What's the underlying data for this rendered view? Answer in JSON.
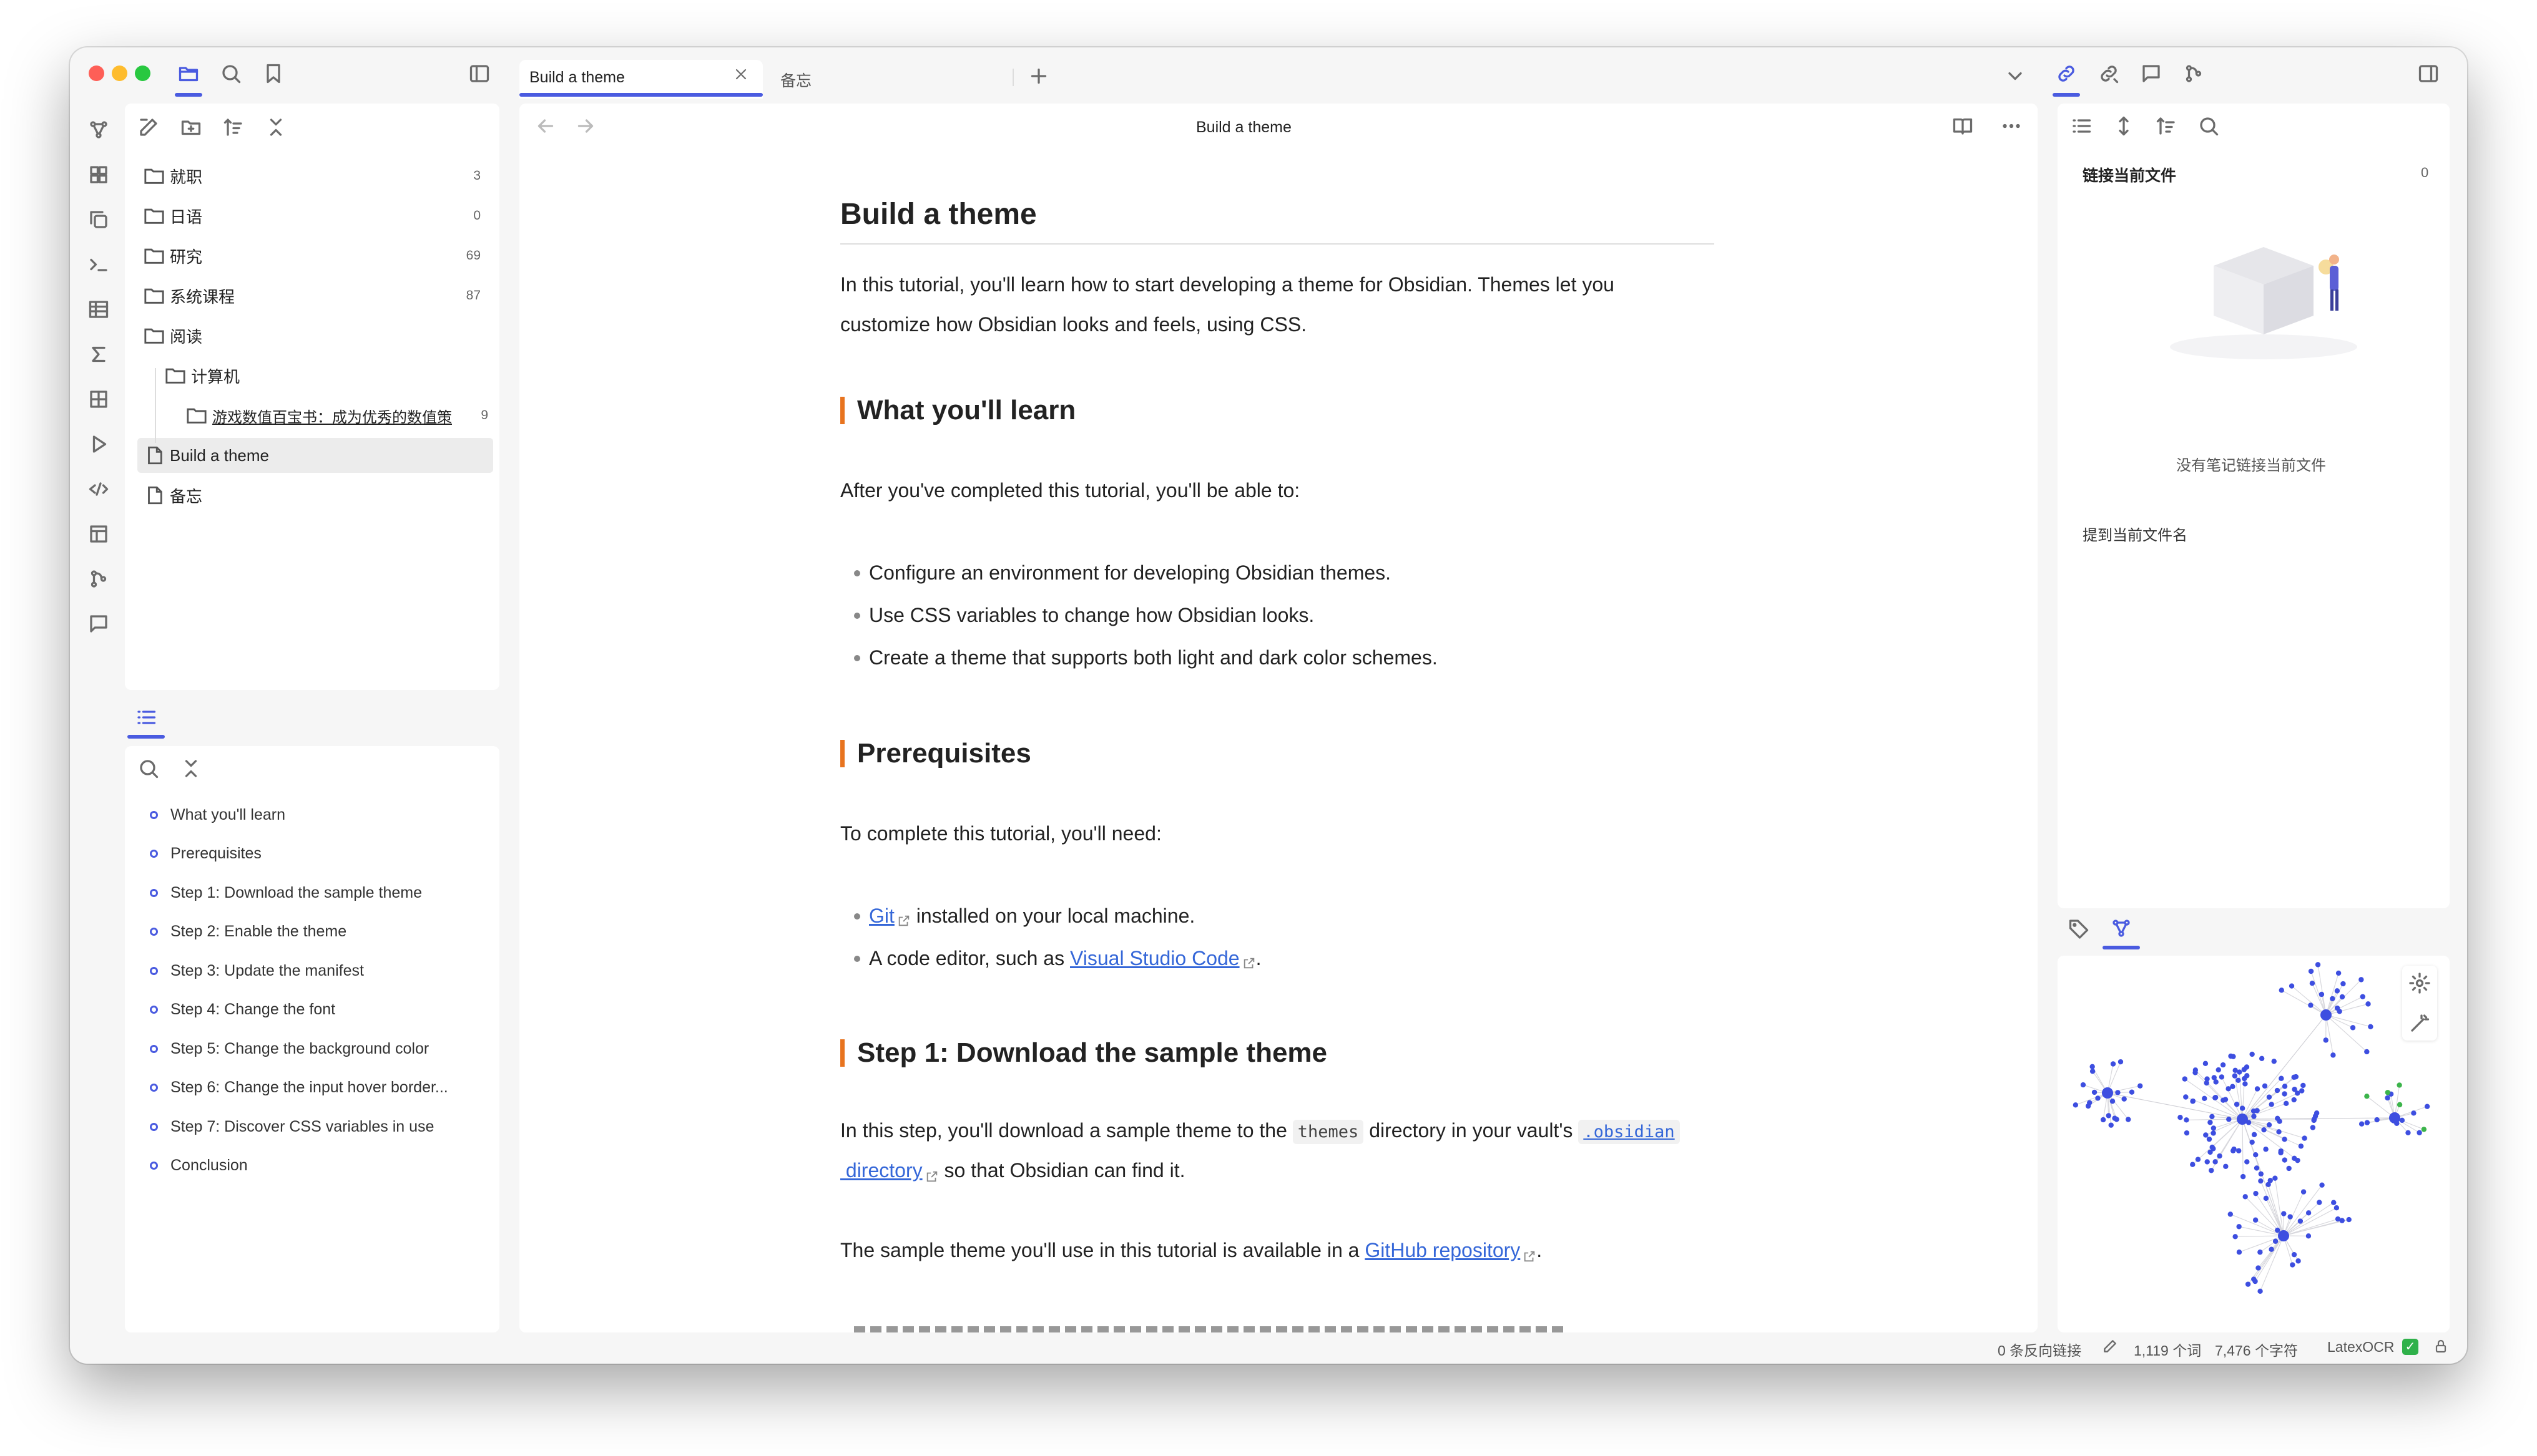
{
  "titlebar": {
    "tabs": [
      {
        "label": "Build a theme",
        "active": true
      },
      {
        "label": "备忘",
        "active": false
      }
    ]
  },
  "left_panel": {
    "tree": [
      {
        "label": "就职",
        "count": "3",
        "type": "folder",
        "level": 0
      },
      {
        "label": "日语",
        "count": "0",
        "type": "folder",
        "level": 0
      },
      {
        "label": "研究",
        "count": "69",
        "type": "folder",
        "level": 0
      },
      {
        "label": "系统课程",
        "count": "87",
        "type": "folder",
        "level": 0
      },
      {
        "label": "阅读",
        "count": "",
        "type": "folder-open",
        "level": 0
      },
      {
        "label": "计算机",
        "count": "",
        "type": "folder-open",
        "level": 1
      },
      {
        "label": "游戏数值百宝书：成为优秀的数值策",
        "count": "9",
        "type": "folder",
        "level": 2
      },
      {
        "label": "Build a theme",
        "count": "",
        "type": "file",
        "level": 0,
        "selected": true
      },
      {
        "label": "备忘",
        "count": "",
        "type": "file",
        "level": 0
      }
    ],
    "outline": [
      "What you'll learn",
      "Prerequisites",
      "Step 1: Download the sample theme",
      "Step 2: Enable the theme",
      "Step 3: Update the manifest",
      "Step 4: Change the font",
      "Step 5: Change the background color",
      "Step 6: Change the input hover border...",
      "Step 7: Discover CSS variables in use",
      "Conclusion"
    ]
  },
  "editor": {
    "header_title": "Build a theme",
    "title": "Build a theme",
    "intro_line1": "In this tutorial, you'll learn how to start developing a theme for Obsidian. Themes let you",
    "intro_line2": "customize how Obsidian looks and feels, using CSS.",
    "h_learn": "What you'll learn",
    "learn_intro": "After you've completed this tutorial, you'll be able to:",
    "learn_items": [
      "Configure an environment for developing Obsidian themes.",
      "Use CSS variables to change how Obsidian looks.",
      "Create a theme that supports both light and dark color schemes."
    ],
    "h_prereq": "Prerequisites",
    "prereq_intro": "To complete this tutorial, you'll need:",
    "prereq_git_link": "Git",
    "prereq_git_rest": " installed on your local machine.",
    "prereq_editor_pre": "A code editor, such as ",
    "prereq_editor_link": "Visual Studio Code",
    "prereq_editor_post": ".",
    "h_step1": "Step 1: Download the sample theme",
    "step1_pre": "In this step, you'll download a sample theme to the ",
    "step1_code1": "themes",
    "step1_mid": " directory in your vault's ",
    "step1_code2": ".obsidian",
    "step1_link2": " directory",
    "step1_post": " so that Obsidian can find it.",
    "step1_p2_pre": "The sample theme you'll use in this tutorial is available in a ",
    "step1_p2_link": "GitHub repository",
    "step1_p2_post": "."
  },
  "right_panel": {
    "backlinks_title": "链接当前文件",
    "backlinks_count": "0",
    "empty_text": "没有笔记链接当前文件",
    "unlinked_title": "提到当前文件名"
  },
  "statusbar": {
    "backlinks": "0 条反向链接",
    "words": "1,119 个词",
    "chars": "7,476 个字符",
    "plugin": "LatexOCR"
  },
  "colors": {
    "accent": "#4a5be0",
    "heading_marker": "#e8741f",
    "link": "#3567d8",
    "graph_node": "#3d4ee0",
    "graph_node_green": "#3cb44b"
  }
}
